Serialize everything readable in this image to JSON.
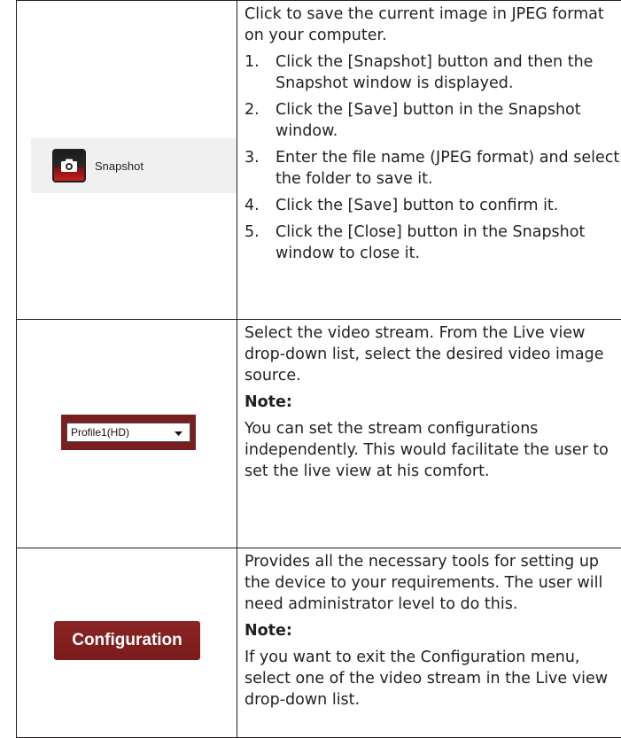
{
  "colors": {
    "text": "#231f20",
    "snapshot_bg": "#f0f0f0",
    "profile_frame": "#7a1f1f",
    "config_button": "#7a1b1b",
    "camera_red": "#c51f1f"
  },
  "rows": {
    "snapshot": {
      "button_label": "Snapshot",
      "icon": "camera-icon",
      "intro": "Click to save the current image in JPEG format on your computer.",
      "steps": [
        {
          "num": "1.",
          "text": "Click the [Snapshot] button and then the Snapshot window is displayed."
        },
        {
          "num": "2.",
          "text": "Click the [Save] button in the Snapshot window."
        },
        {
          "num": "3.",
          "text": "Enter the file name (JPEG format) and select the folder to save it."
        },
        {
          "num": "4.",
          "text": "Click the [Save] button to confirm it."
        },
        {
          "num": "5.",
          "text": "Click the [Close] button in the Snapshot window to close it."
        }
      ]
    },
    "profile": {
      "selected": "Profile1(HD)",
      "icon": "chevron-down-icon",
      "description": "Select the video stream. From the Live view drop-down list, select the desired video image source.",
      "note_label": "Note:",
      "note": "You can set the stream configurations independently. This would facilitate the user to set the live view at his comfort."
    },
    "configuration": {
      "button_label": "Configuration",
      "description": "Provides all the necessary tools for setting up the device to your requirements. The user will need administrator level to do this.",
      "note_label": "Note:",
      "note": "If you want to exit the Configuration menu, select one of the video stream in the Live view drop-down list."
    }
  }
}
